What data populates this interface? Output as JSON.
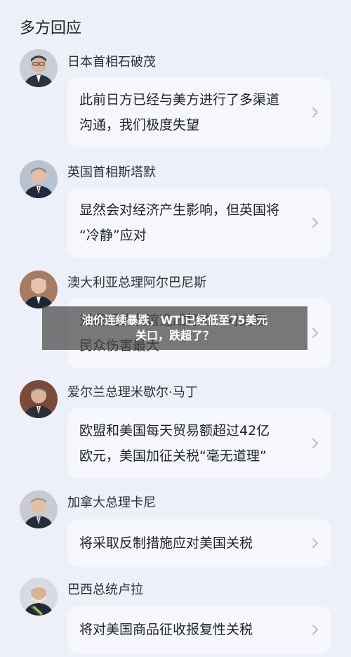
{
  "section": {
    "title": "多方回应"
  },
  "leaders": [
    {
      "name": "日本首相石破茂",
      "response": "此前日方已经与美方进行了多渠道\n沟通，我们极度失望",
      "avatar_icon": "person-portrait-icon"
    },
    {
      "name": "英国首相斯塔默",
      "response": "显然会对经济产生影响，但英国将\n“冷静”应对",
      "avatar_icon": "person-portrait-icon"
    },
    {
      "name": "澳大利亚总理阿尔巴尼斯",
      "response": "对我们的友谊造成打击，对美国\n民众伤害最大",
      "avatar_icon": "person-portrait-icon"
    },
    {
      "name": "爱尔兰总理米歇尔·马丁",
      "response": "欧盟和美国每天贸易额超过42亿\n欧元，美国加征关税“毫无道理”",
      "avatar_icon": "person-portrait-icon"
    },
    {
      "name": "加拿大总理卡尼",
      "response": "将采取反制措施应对美国关税",
      "avatar_icon": "person-portrait-icon"
    },
    {
      "name": "巴西总统卢拉",
      "response": "将对美国商品征收报复性关税",
      "avatar_icon": "person-portrait-icon"
    }
  ],
  "overlay": {
    "text": "油价连续暴跌，WTI已经低至75美元\n关口，跌超了？"
  },
  "colors": {
    "background": "#edf0f8",
    "bubble": "#f5f7fc",
    "chevron": "#b8bec8"
  }
}
